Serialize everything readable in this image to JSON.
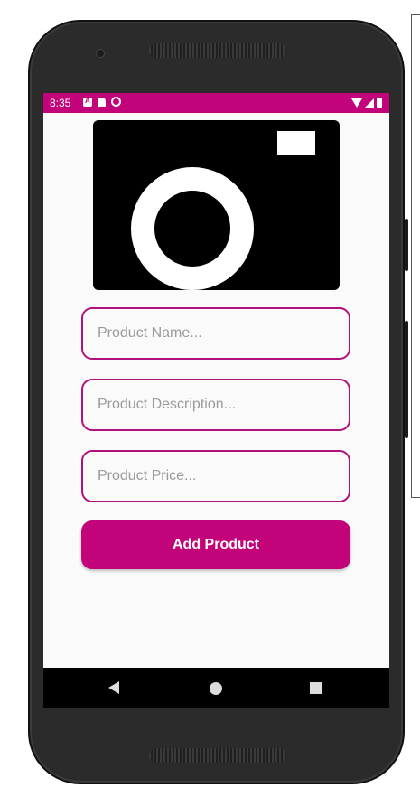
{
  "status_bar": {
    "time": "8:35",
    "icons_left": [
      "a-notification-icon",
      "sd-card-icon",
      "sync-icon"
    ],
    "icons_right": [
      "wifi-icon",
      "signal-icon",
      "battery-icon"
    ],
    "color": "#c2037a"
  },
  "product_image": {
    "icon": "camera-icon"
  },
  "form": {
    "name_placeholder": "Product Name...",
    "name_value": "",
    "description_placeholder": "Product Description...",
    "description_value": "",
    "price_placeholder": "Product Price...",
    "price_value": "",
    "submit_label": "Add Product"
  },
  "nav_bar": {
    "buttons": [
      "back-icon",
      "home-icon",
      "recents-icon"
    ]
  },
  "colors": {
    "accent": "#c2037a",
    "field_border": "#b0117a",
    "screen_bg": "#fafafa"
  }
}
